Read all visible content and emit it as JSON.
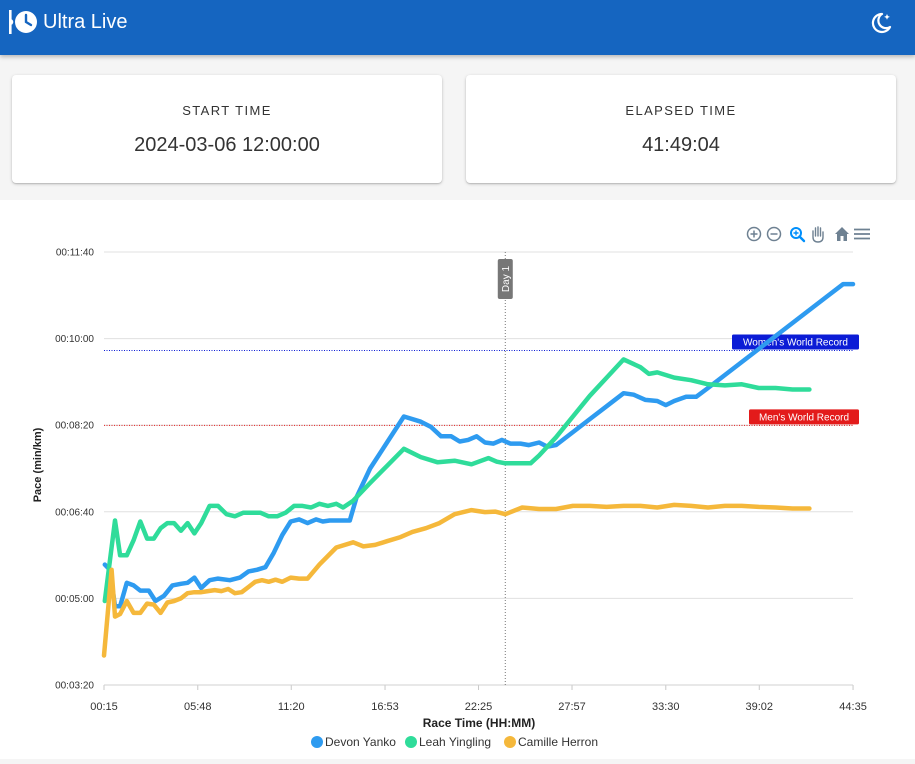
{
  "app": {
    "title": "Ultra Live"
  },
  "cards": {
    "start_time": {
      "label": "START TIME",
      "value": "2024-03-06 12:00:00"
    },
    "elapsed_time": {
      "label": "ELAPSED TIME",
      "value": "41:49:04"
    }
  },
  "toolbar": [
    "zoom-in-icon",
    "zoom-out-icon",
    "selection-zoom-icon",
    "pan-icon",
    "reset-home-icon",
    "menu-icon"
  ],
  "chart_data": {
    "type": "line",
    "xlabel": "Race Time (HH:MM)",
    "ylabel": "Pace (min/km)",
    "x_unit": "hours",
    "xlim": [
      0.25,
      44.58
    ],
    "ylim": [
      3.333,
      11.667
    ],
    "x_ticks": [
      {
        "v": 0.25,
        "label": "00:15"
      },
      {
        "v": 5.8,
        "label": "05:48"
      },
      {
        "v": 11.333,
        "label": "11:20"
      },
      {
        "v": 16.883,
        "label": "16:53"
      },
      {
        "v": 22.417,
        "label": "22:25"
      },
      {
        "v": 27.95,
        "label": "27:57"
      },
      {
        "v": 33.5,
        "label": "33:30"
      },
      {
        "v": 39.033,
        "label": "39:02"
      },
      {
        "v": 44.583,
        "label": "44:35"
      }
    ],
    "y_ticks": [
      {
        "v": 3.333,
        "label": "00:03:20"
      },
      {
        "v": 5.0,
        "label": "00:05:00"
      },
      {
        "v": 6.667,
        "label": "00:06:40"
      },
      {
        "v": 8.333,
        "label": "00:08:20"
      },
      {
        "v": 10.0,
        "label": "00:10:00"
      },
      {
        "v": 11.667,
        "label": "00:11:40"
      }
    ],
    "annotations": [
      {
        "type": "vline",
        "x": 24.0,
        "label": "Day 1",
        "color": "#777777"
      },
      {
        "type": "hline",
        "y": 9.77,
        "label": "Women's World Record",
        "color": "#0b1cd6"
      },
      {
        "type": "hline",
        "y": 8.33,
        "label": "Men's World Record",
        "color": "#e31b1b"
      }
    ],
    "legend_position": "bottom-center",
    "series": [
      {
        "name": "Devon Yanko",
        "color": "#2e9bf0",
        "x": [
          0.3,
          0.6,
          0.9,
          1.2,
          1.6,
          2.0,
          2.4,
          2.9,
          3.3,
          3.8,
          4.3,
          4.8,
          5.2,
          5.6,
          6.0,
          6.5,
          7.0,
          7.7,
          8.3,
          8.8,
          9.3,
          9.8,
          10.3,
          10.8,
          11.3,
          11.8,
          12.3,
          12.8,
          13.2,
          13.6,
          14.2,
          14.8,
          15.2,
          16.0,
          17.0,
          18.0,
          19.0,
          19.6,
          20.2,
          20.8,
          21.3,
          21.8,
          22.3,
          22.8,
          23.3,
          23.8,
          24.3,
          24.9,
          25.4,
          26.0,
          26.5,
          27.0,
          28.0,
          29.0,
          30.0,
          31.0,
          31.6,
          32.3,
          33.0,
          33.5,
          34.0,
          34.7,
          35.3,
          36.0,
          37.0,
          38.0,
          39.0,
          40.0,
          41.0,
          42.0,
          43.0,
          44.0,
          44.58
        ],
        "y": [
          5.65,
          5.55,
          4.85,
          4.85,
          5.3,
          5.25,
          5.15,
          5.15,
          4.95,
          5.05,
          5.25,
          5.28,
          5.3,
          5.4,
          5.2,
          5.35,
          5.38,
          5.35,
          5.4,
          5.52,
          5.55,
          5.6,
          5.88,
          6.22,
          6.48,
          6.52,
          6.45,
          6.52,
          6.48,
          6.5,
          6.5,
          6.5,
          6.95,
          7.5,
          8.0,
          8.5,
          8.4,
          8.3,
          8.12,
          8.12,
          8.02,
          8.05,
          8.12,
          8.0,
          7.98,
          8.05,
          7.98,
          7.98,
          7.95,
          8.0,
          7.92,
          7.95,
          8.2,
          8.45,
          8.7,
          8.95,
          8.92,
          8.82,
          8.8,
          8.72,
          8.8,
          8.88,
          8.88,
          9.05,
          9.3,
          9.55,
          9.8,
          10.05,
          10.3,
          10.55,
          10.8,
          11.05,
          11.05
        ]
      },
      {
        "name": "Leah Yingling",
        "color": "#2fdc9a",
        "x": [
          0.3,
          0.9,
          1.2,
          1.6,
          2.0,
          2.4,
          2.8,
          3.2,
          3.6,
          4.0,
          4.4,
          4.8,
          5.2,
          5.6,
          6.0,
          6.5,
          7.0,
          7.5,
          8.0,
          8.5,
          9.0,
          9.5,
          10.0,
          10.5,
          11.0,
          11.5,
          12.0,
          12.5,
          13.0,
          13.5,
          14.0,
          14.4,
          15.0,
          16.0,
          17.0,
          18.0,
          19.0,
          20.0,
          21.0,
          22.0,
          23.0,
          23.5,
          24.0,
          24.5,
          25.0,
          25.5,
          26.0,
          27.0,
          28.0,
          29.0,
          30.0,
          31.0,
          32.0,
          32.5,
          33.0,
          33.5,
          34.0,
          35.0,
          36.0,
          37.0,
          38.0,
          39.0,
          40.0,
          41.0,
          42.0
        ],
        "y": [
          4.95,
          6.5,
          5.83,
          5.83,
          6.12,
          6.48,
          6.15,
          6.15,
          6.35,
          6.45,
          6.45,
          6.3,
          6.45,
          6.25,
          6.45,
          6.78,
          6.78,
          6.62,
          6.58,
          6.65,
          6.65,
          6.65,
          6.58,
          6.58,
          6.65,
          6.78,
          6.78,
          6.75,
          6.82,
          6.78,
          6.82,
          6.75,
          6.88,
          7.22,
          7.55,
          7.88,
          7.72,
          7.62,
          7.65,
          7.58,
          7.7,
          7.63,
          7.6,
          7.6,
          7.6,
          7.6,
          7.75,
          8.1,
          8.5,
          8.9,
          9.25,
          9.6,
          9.45,
          9.32,
          9.35,
          9.3,
          9.25,
          9.2,
          9.12,
          9.1,
          9.12,
          9.05,
          9.05,
          9.02,
          9.02
        ]
      },
      {
        "name": "Camille Herron",
        "color": "#f5b83b",
        "x": [
          0.25,
          0.7,
          0.9,
          1.2,
          1.6,
          2.0,
          2.4,
          2.8,
          3.2,
          3.6,
          4.0,
          4.4,
          4.8,
          5.2,
          5.6,
          6.0,
          6.4,
          6.8,
          7.2,
          7.6,
          8.0,
          8.4,
          8.8,
          9.2,
          9.6,
          10.0,
          10.4,
          10.8,
          11.3,
          11.8,
          12.3,
          13.0,
          14.0,
          15.0,
          15.6,
          16.3,
          17.0,
          17.8,
          18.5,
          19.3,
          20.1,
          21.0,
          22.0,
          22.8,
          23.4,
          24.0,
          25.0,
          26.0,
          27.0,
          28.0,
          29.0,
          30.0,
          31.0,
          32.0,
          33.0,
          34.0,
          35.0,
          36.0,
          37.0,
          38.0,
          39.0,
          40.0,
          41.0,
          42.0
        ],
        "y": [
          3.9,
          5.55,
          4.65,
          4.7,
          4.95,
          4.72,
          4.72,
          4.9,
          4.88,
          4.72,
          4.92,
          4.95,
          5.0,
          5.1,
          5.12,
          5.12,
          5.14,
          5.16,
          5.14,
          5.18,
          5.1,
          5.12,
          5.22,
          5.32,
          5.35,
          5.32,
          5.36,
          5.32,
          5.4,
          5.38,
          5.38,
          5.65,
          5.98,
          6.08,
          6.0,
          6.03,
          6.1,
          6.18,
          6.28,
          6.35,
          6.45,
          6.62,
          6.7,
          6.66,
          6.67,
          6.62,
          6.75,
          6.72,
          6.72,
          6.78,
          6.78,
          6.76,
          6.78,
          6.78,
          6.75,
          6.8,
          6.78,
          6.75,
          6.78,
          6.78,
          6.76,
          6.75,
          6.73,
          6.73
        ]
      }
    ]
  }
}
